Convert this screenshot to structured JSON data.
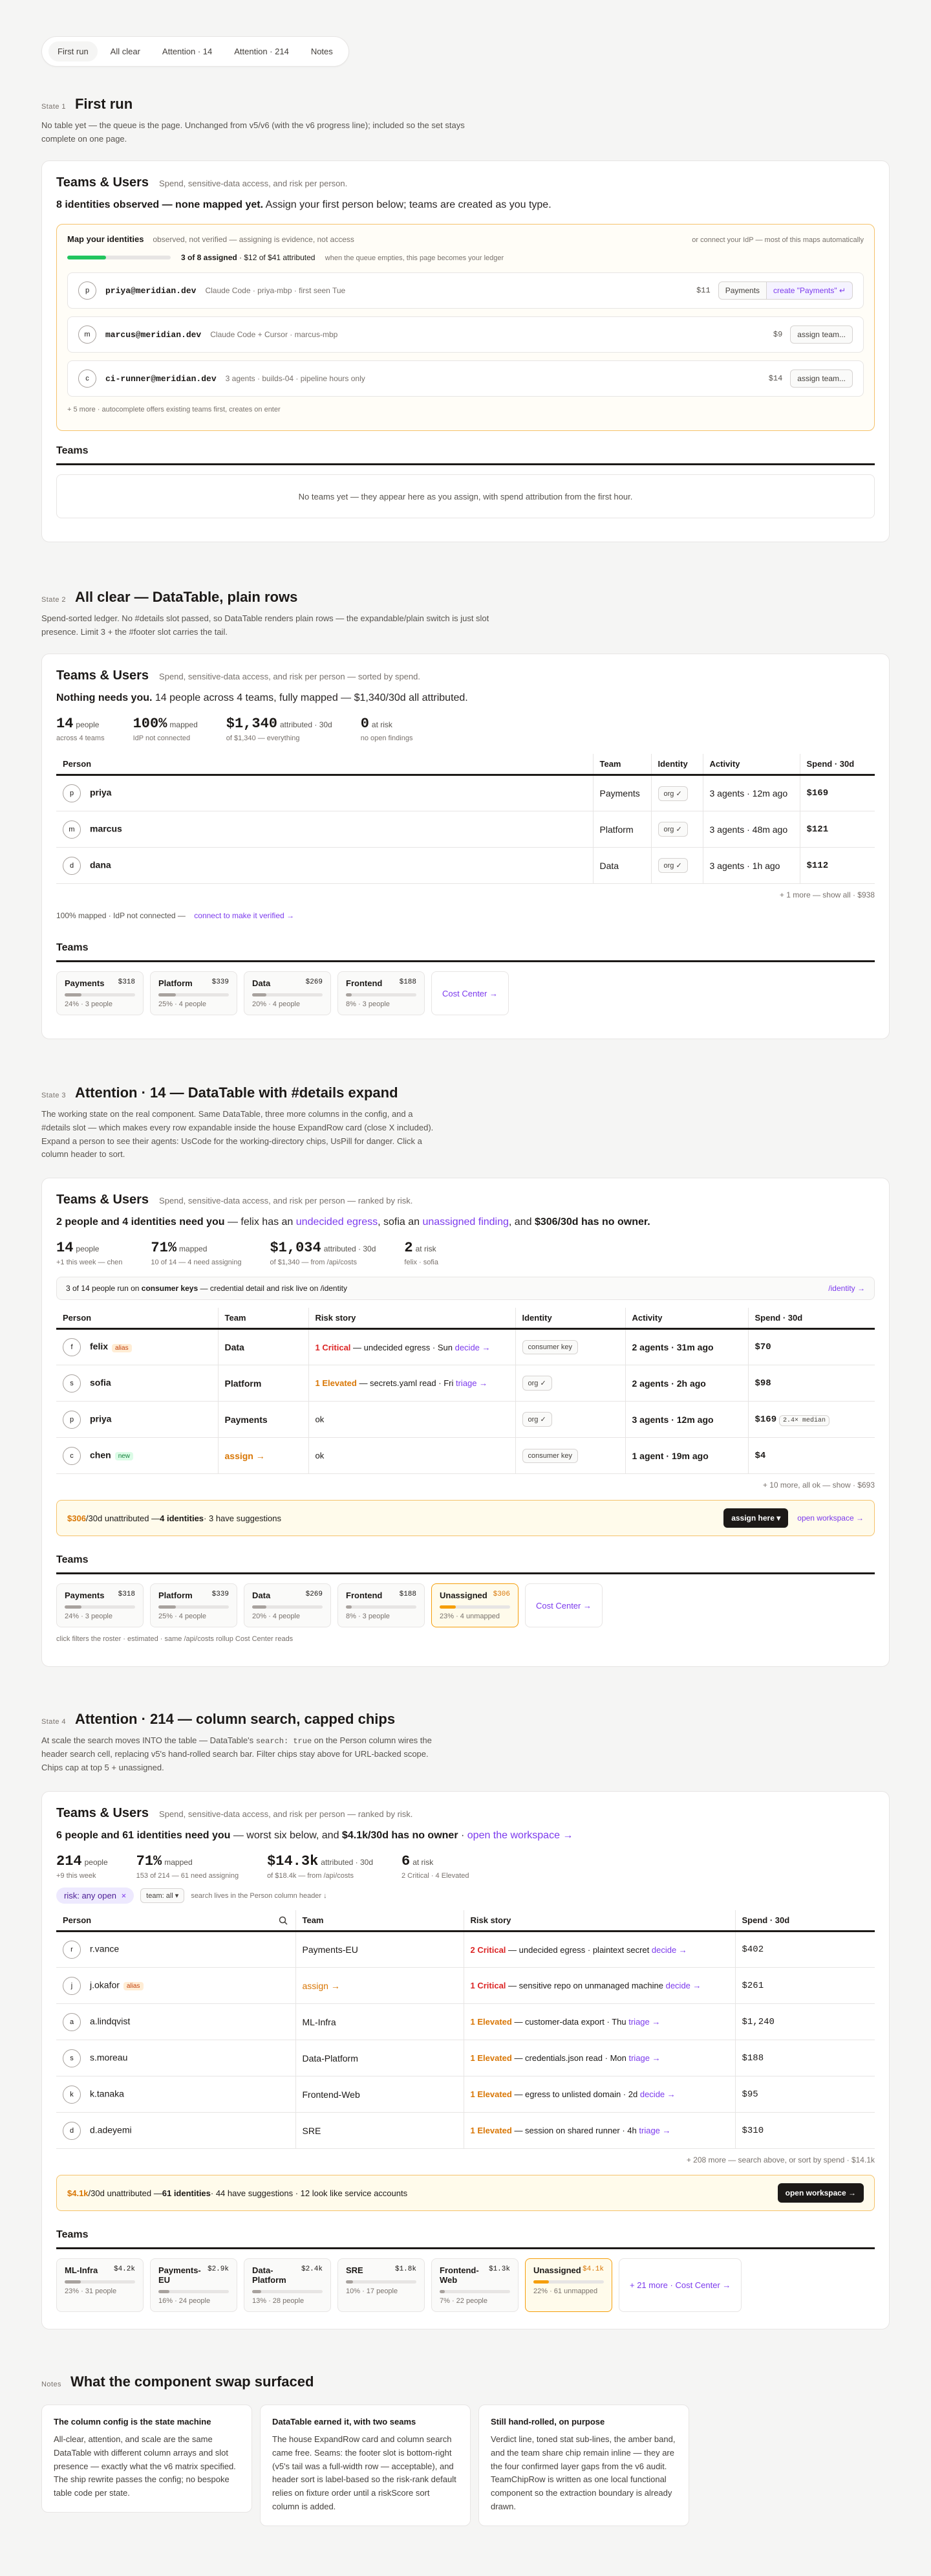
{
  "tabs": [
    "First run",
    "All clear",
    "Attention · 14",
    "Attention · 214",
    "Notes"
  ],
  "card_title": "Teams & Users",
  "teams_title": "Teams",
  "state1": {
    "num": "State 1",
    "name": "First run",
    "desc": "No table yet — the queue is the page. Unchanged from v5/v6 (with the v6 progress line); included so the set stays complete on one page.",
    "sub": "Spend, sensitive-data access, and risk per person.",
    "headline_b": "8 identities observed — none mapped yet.",
    "headline_rest": " Assign your first person below; teams are created as you type.",
    "panel_title": "Map your identities",
    "panel_sub": "observed, not verified — assigning is evidence, not access",
    "panel_right": "or connect your IdP — most of this maps automatically",
    "progress_bold": "3 of 8 assigned",
    "progress_rest": " · $12 of $41 attributed",
    "progress_note": "when the queue empties, this page becomes your ledger",
    "rows": [
      {
        "initial": "p",
        "id": "priya@meridian.dev",
        "desc": "Claude Code · priya-mbp · first seen Tue",
        "amt": "$11",
        "team": "Payments",
        "action": "create \"Payments\" ↵"
      },
      {
        "initial": "m",
        "id": "marcus@meridian.dev",
        "desc": "Claude Code + Cursor · marcus-mbp",
        "amt": "$9",
        "action": "assign team..."
      },
      {
        "initial": "c",
        "id": "ci-runner@meridian.dev",
        "desc": "3 agents · builds-04 · pipeline hours only",
        "amt": "$14",
        "action": "assign team..."
      }
    ],
    "more": "+ 5 more · autocomplete offers existing teams first, creates on enter",
    "no_teams": "No teams yet — they appear here as you assign, with spend attribution from the first hour."
  },
  "state2": {
    "num": "State 2",
    "name": "All clear — DataTable, plain rows",
    "desc": "Spend-sorted ledger. No #details slot passed, so DataTable renders plain rows — the expandable/plain switch is just slot presence. Limit 3 + the #footer slot carries the tail.",
    "sub": "Spend, sensitive-data access, and risk per person — sorted by spend.",
    "hl_green": "Nothing needs you.",
    "hl_rest": " 14 people across 4 teams, fully mapped — $1,340/30d all attributed.",
    "stats": [
      {
        "big": "14",
        "unit": "people",
        "small": "across 4 teams",
        "cls": ""
      },
      {
        "big": "100%",
        "unit": "mapped",
        "small": "IdP not connected",
        "cls": "green"
      },
      {
        "big": "$1,340",
        "unit": "attributed · 30d",
        "small": "of $1,340 — everything",
        "cls": ""
      },
      {
        "big": "0",
        "unit": "at risk",
        "small": "no open findings",
        "cls": "green"
      }
    ],
    "cols": [
      "Person",
      "Team",
      "Identity",
      "Activity",
      "Spend · 30d"
    ],
    "rows": [
      {
        "initial": "p",
        "name": "priya",
        "team": "Payments",
        "identity": "org ✓",
        "activity": "3 agents · 12m ago",
        "spend": "$169"
      },
      {
        "initial": "m",
        "name": "marcus",
        "team": "Platform",
        "identity": "org ✓",
        "activity": "3 agents · 48m ago",
        "spend": "$121"
      },
      {
        "initial": "d",
        "name": "dana",
        "team": "Data",
        "identity": "org ✓",
        "activity": "3 agents · 1h ago",
        "spend": "$112"
      }
    ],
    "footer": "+ 1 more — show all · $938",
    "idp_text": "100% mapped · IdP not connected —",
    "idp_link": "connect to make it verified →",
    "teams": [
      {
        "name": "Payments",
        "value": "$318",
        "meta": "24% · 3 people",
        "pct": 24
      },
      {
        "name": "Platform",
        "value": "$339",
        "meta": "25% · 4 people",
        "pct": 25
      },
      {
        "name": "Data",
        "value": "$269",
        "meta": "20% · 4 people",
        "pct": 20
      },
      {
        "name": "Frontend",
        "value": "$188",
        "meta": "8% · 3 people",
        "pct": 8
      }
    ],
    "cost_center": "Cost Center →"
  },
  "state3": {
    "num": "State 3",
    "name": "Attention · 14 — DataTable with #details expand",
    "desc": "The working state on the real component. Same DataTable, three more columns in the config, and a #details slot — which makes every row expandable inside the house ExpandRow card (close X included). Expand a person to see their agents: UsCode for the working-directory chips, UsPill for danger. Click a column header to sort.",
    "sub": "Spend, sensitive-data access, and risk per person — ranked by risk.",
    "hl_b": "2 people and 4 identities need you",
    "hl_1": " — felix has an ",
    "hl_l1": "undecided egress",
    "hl_2": ", sofia an ",
    "hl_l2": "unassigned finding",
    "hl_3": ", and ",
    "hl_o": "$306/30d has no owner.",
    "stats": [
      {
        "big": "14",
        "unit": "people",
        "small": "+1 this week — chen",
        "cls": "green"
      },
      {
        "big": "71%",
        "unit": "mapped",
        "small": "10 of 14 — 4 need assigning",
        "cls": "orange"
      },
      {
        "big": "$1,034",
        "unit": "attributed · 30d",
        "small": "of $1,340 — from /api/costs",
        "cls": ""
      },
      {
        "big": "2",
        "unit": "at risk",
        "small": "felix · sofia",
        "cls": "red"
      }
    ],
    "keys_pre": "3 of 14 people run on ",
    "keys_b": "consumer keys",
    "keys_post": " — credential detail and risk live on /identity",
    "keys_link": "/identity →",
    "cols": [
      "Person",
      "Team",
      "Risk story",
      "Identity",
      "Activity",
      "Spend · 30d"
    ],
    "rows": [
      {
        "initial": "f",
        "name": "felix",
        "badge": "alias",
        "team": "Data",
        "risk_sev": "1 Critical",
        "risk_text": " — undecided egress · Sun",
        "risk_action": "decide →",
        "identity": "consumer key",
        "activity": "2 agents · 31m ago",
        "spend": "$70",
        "extra": ""
      },
      {
        "initial": "s",
        "name": "sofia",
        "badge": "",
        "team": "Platform",
        "risk_sev": "1 Elevated",
        "risk_text": " — secrets.yaml read · Fri",
        "risk_action": "triage →",
        "identity": "org ✓",
        "activity": "2 agents · 2h ago",
        "spend": "$98",
        "extra": ""
      },
      {
        "initial": "p",
        "name": "priya",
        "badge": "",
        "team": "Payments",
        "risk_sev": "",
        "risk_text": "ok",
        "risk_action": "",
        "identity": "org ✓",
        "activity": "3 agents · 12m ago",
        "spend": "$169",
        "extra": "2.4× median"
      },
      {
        "initial": "c",
        "name": "chen",
        "badge": "new",
        "team": "assign →",
        "risk_sev": "",
        "risk_text": "ok",
        "risk_action": "",
        "identity": "consumer key",
        "activity": "1 agent · 19m ago",
        "spend": "$4",
        "extra": ""
      }
    ],
    "footer": "+ 10 more, all ok — show · $693",
    "unattr_o": "$306",
    "unattr_1": "/30d unattributed — ",
    "unattr_b": "4 identities",
    "unattr_2": " · 3 have suggestions",
    "assign_btn": "assign here ▾",
    "open_ws": "open workspace →",
    "teams": [
      {
        "name": "Payments",
        "value": "$318",
        "meta": "24% · 3 people",
        "pct": 24
      },
      {
        "name": "Platform",
        "value": "$339",
        "meta": "25% · 4 people",
        "pct": 25
      },
      {
        "name": "Data",
        "value": "$269",
        "meta": "20% · 4 people",
        "pct": 20
      },
      {
        "name": "Frontend",
        "value": "$188",
        "meta": "8% · 3 people",
        "pct": 8
      }
    ],
    "unassigned": {
      "name": "Unassigned",
      "value": "$306",
      "meta": "23% · 4 unmapped",
      "pct": 23
    },
    "cost_center": "Cost Center →",
    "filter_note": "click filters the roster · estimated · same /api/costs rollup Cost Center reads"
  },
  "state4": {
    "num": "State 4",
    "name": "Attention · 214 — column search, capped chips",
    "desc_1": "At scale the search moves INTO the table — DataTable's ",
    "desc_code": "search: true",
    "desc_2": " on the Person column wires the header search cell, replacing v5's hand-rolled search bar. Filter chips stay above for URL-backed scope. Chips cap at top 5 + unassigned.",
    "sub": "Spend, sensitive-data access, and risk per person — ranked by risk.",
    "hl_b": "6 people and 61 identities need you",
    "hl_1": " — worst six below, and ",
    "hl_o": "$4.1k/30d has no owner",
    "hl_2": " · ",
    "hl_l": "open the workspace →",
    "stats": [
      {
        "big": "214",
        "unit": "people",
        "small": "+9 this week",
        "cls": "green"
      },
      {
        "big": "71%",
        "unit": "mapped",
        "small": "153 of 214 — 61 need assigning",
        "cls": "orange"
      },
      {
        "big": "$14.3k",
        "unit": "attributed · 30d",
        "small": "of $18.4k — from /api/costs",
        "cls": ""
      },
      {
        "big": "6",
        "unit": "at risk",
        "small": "2 Critical · 4 Elevated",
        "cls": "red"
      }
    ],
    "chip_risk": "risk: any open",
    "chip_team": "team: all ▾",
    "chip_note": "search lives in the Person column header ↓",
    "cols": [
      "Person",
      "Team",
      "Risk story",
      "Spend · 30d"
    ],
    "rows": [
      {
        "initial": "r",
        "name": "r.vance",
        "badge": "",
        "team": "Payments-EU",
        "risk_sev": "2 Critical",
        "sev": "crit",
        "risk_text": " — undecided egress · plaintext secret",
        "risk_action": "decide →",
        "spend": "$402"
      },
      {
        "initial": "j",
        "name": "j.okafor",
        "badge": "alias",
        "team": "assign →",
        "risk_sev": "1 Critical",
        "sev": "crit",
        "risk_text": " — sensitive repo on unmanaged machine",
        "risk_action": "decide →",
        "spend": "$261"
      },
      {
        "initial": "a",
        "name": "a.lindqvist",
        "badge": "",
        "team": "ML-Infra",
        "risk_sev": "1 Elevated",
        "sev": "elev",
        "risk_text": " — customer-data export · Thu",
        "risk_action": "triage →",
        "spend": "$1,240"
      },
      {
        "initial": "s",
        "name": "s.moreau",
        "badge": "",
        "team": "Data-Platform",
        "risk_sev": "1 Elevated",
        "sev": "elev",
        "risk_text": " — credentials.json read · Mon",
        "risk_action": "triage →",
        "spend": "$188"
      },
      {
        "initial": "k",
        "name": "k.tanaka",
        "badge": "",
        "team": "Frontend-Web",
        "risk_sev": "1 Elevated",
        "sev": "elev",
        "risk_text": " — egress to unlisted domain · 2d",
        "risk_action": "decide →",
        "spend": "$95"
      },
      {
        "initial": "d",
        "name": "d.adeyemi",
        "badge": "",
        "team": "SRE",
        "risk_sev": "1 Elevated",
        "sev": "elev",
        "risk_text": " — session on shared runner · 4h",
        "risk_action": "triage →",
        "spend": "$310"
      }
    ],
    "footer": "+ 208 more — search above, or sort by spend · $14.1k",
    "unattr_o": "$4.1k",
    "unattr_1": "/30d unattributed — ",
    "unattr_b": "61 identities",
    "unattr_2": " · 44 have suggestions · 12 look like service accounts",
    "open_ws": "open workspace →",
    "teams": [
      {
        "name": "ML-Infra",
        "value": "$4.2k",
        "meta": "23% · 31 people",
        "pct": 23
      },
      {
        "name": "Payments-EU",
        "value": "$2.9k",
        "meta": "16% · 24 people",
        "pct": 16
      },
      {
        "name": "Data-Platform",
        "value": "$2.4k",
        "meta": "13% · 28 people",
        "pct": 13
      },
      {
        "name": "SRE",
        "value": "$1.8k",
        "meta": "10% · 17 people",
        "pct": 10
      },
      {
        "name": "Frontend-Web",
        "value": "$1.3k",
        "meta": "7% · 22 people",
        "pct": 7
      }
    ],
    "unassigned": {
      "name": "Unassigned",
      "value": "$4.1k",
      "meta": "22% · 61 unmapped",
      "pct": 22
    },
    "more_link": "+ 21 more · Cost Center →"
  },
  "notes": {
    "num": "Notes",
    "name": "What the component swap surfaced",
    "cards": [
      {
        "title": "The column config is the state machine",
        "body": "All-clear, attention, and scale are the same DataTable with different column arrays and slot presence — exactly what the v6 matrix specified. The ship rewrite passes the config; no bespoke table code per state."
      },
      {
        "title": "DataTable earned it, with two seams",
        "body": "The house ExpandRow card and column search came free. Seams: the footer slot is bottom-right (v5's tail was a full-width row — acceptable), and header sort is label-based so the risk-rank default relies on fixture order until a riskScore sort column is added."
      },
      {
        "title": "Still hand-rolled, on purpose",
        "body": "Verdict line, toned stat sub-lines, the amber band, and the team share chip remain inline — they are the four confirmed layer gaps from the v6 audit. TeamChipRow is written as one local functional component so the extraction boundary is already drawn."
      }
    ]
  }
}
